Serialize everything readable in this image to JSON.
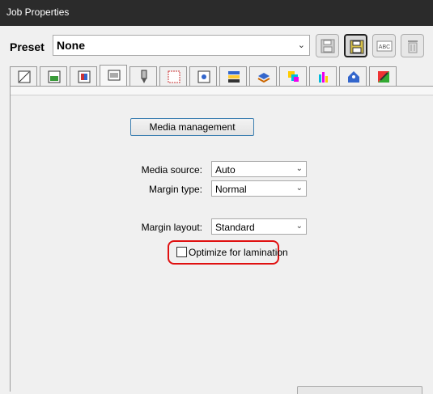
{
  "window": {
    "title": "Job Properties"
  },
  "preset": {
    "label": "Preset",
    "value": "None",
    "toolbar": [
      "save-icon",
      "save-as-icon",
      "rename-icon",
      "delete-icon"
    ]
  },
  "tabs": [
    "layout-icon",
    "image-icon",
    "color-page-icon",
    "printer-icon",
    "pen-icon",
    "grid-icon",
    "target-icon",
    "stack-icon",
    "layers-icon",
    "cmyk-icon",
    "bars-icon",
    "tag-icon",
    "palette-icon"
  ],
  "media_management_label": "Media management",
  "media_source": {
    "label": "Media source:",
    "value": "Auto"
  },
  "margin_type": {
    "label": "Margin type:",
    "value": "Normal"
  },
  "margin_layout": {
    "label": "Margin layout:",
    "value": "Standard"
  },
  "optimize": {
    "label": "Optimize for lamination",
    "checked": false
  },
  "colors": {
    "highlight": "#e01010",
    "button_border": "#3c7fb1"
  }
}
